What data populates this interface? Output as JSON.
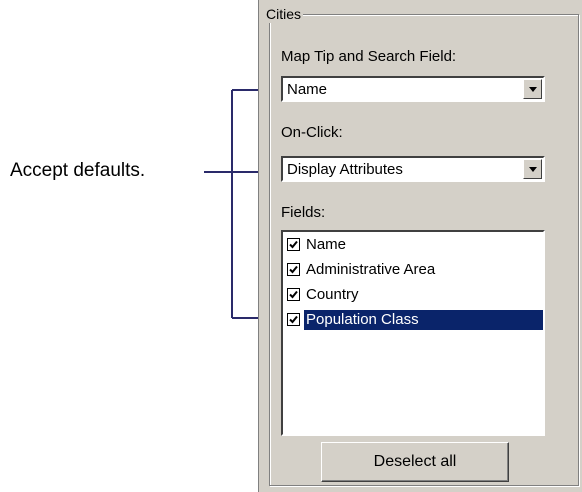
{
  "callout": {
    "text": "Accept defaults."
  },
  "group": {
    "title": "Cities"
  },
  "map_tip": {
    "label": "Map Tip and Search Field:",
    "value": "Name"
  },
  "on_click": {
    "label": "On-Click:",
    "value": "Display Attributes"
  },
  "fields": {
    "label": "Fields:",
    "items": [
      {
        "label": "Name",
        "checked": true
      },
      {
        "label": "Administrative Area",
        "checked": true
      },
      {
        "label": "Country",
        "checked": true
      },
      {
        "label": "Population Class",
        "checked": true,
        "selected": true
      }
    ]
  },
  "deselect_button": {
    "label": "Deselect all"
  },
  "colors": {
    "panel_bg": "#d4d0c8",
    "selection_bg": "#0a246a",
    "bracket_line": "#2a2a6a"
  }
}
